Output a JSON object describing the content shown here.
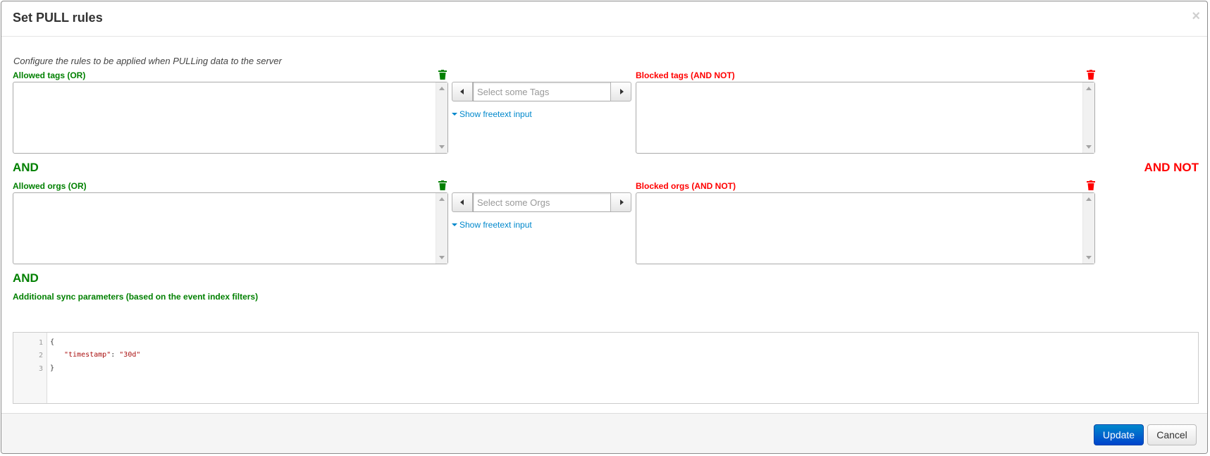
{
  "modal": {
    "title": "Set PULL rules",
    "close_glyph": "×",
    "description": "Configure the rules to be applied when PULLing data to the server"
  },
  "tags": {
    "allowed_label": "Allowed tags (OR)",
    "blocked_label": "Blocked tags (AND NOT)",
    "picker_placeholder": "Select some Tags",
    "freetext_link": "Show freetext input"
  },
  "connectors": {
    "and_1": "AND",
    "and_not": "AND NOT",
    "and_2": "AND"
  },
  "orgs": {
    "allowed_label": "Allowed orgs (OR)",
    "blocked_label": "Blocked orgs (AND NOT)",
    "picker_placeholder": "Select some Orgs",
    "freetext_link": "Show freetext input"
  },
  "sync": {
    "label": "Additional sync parameters (based on the event index filters)",
    "line_numbers": [
      "1",
      "2",
      "3"
    ],
    "code_open": "{",
    "code_key": "\"timestamp\"",
    "code_sep": ": ",
    "code_value": "\"30d\"",
    "code_close": "}"
  },
  "footer": {
    "update_label": "Update",
    "cancel_label": "Cancel"
  },
  "colors": {
    "allowed": "#008000",
    "blocked": "#ff0000",
    "link": "#0088cc",
    "primary": "#0055cc"
  }
}
